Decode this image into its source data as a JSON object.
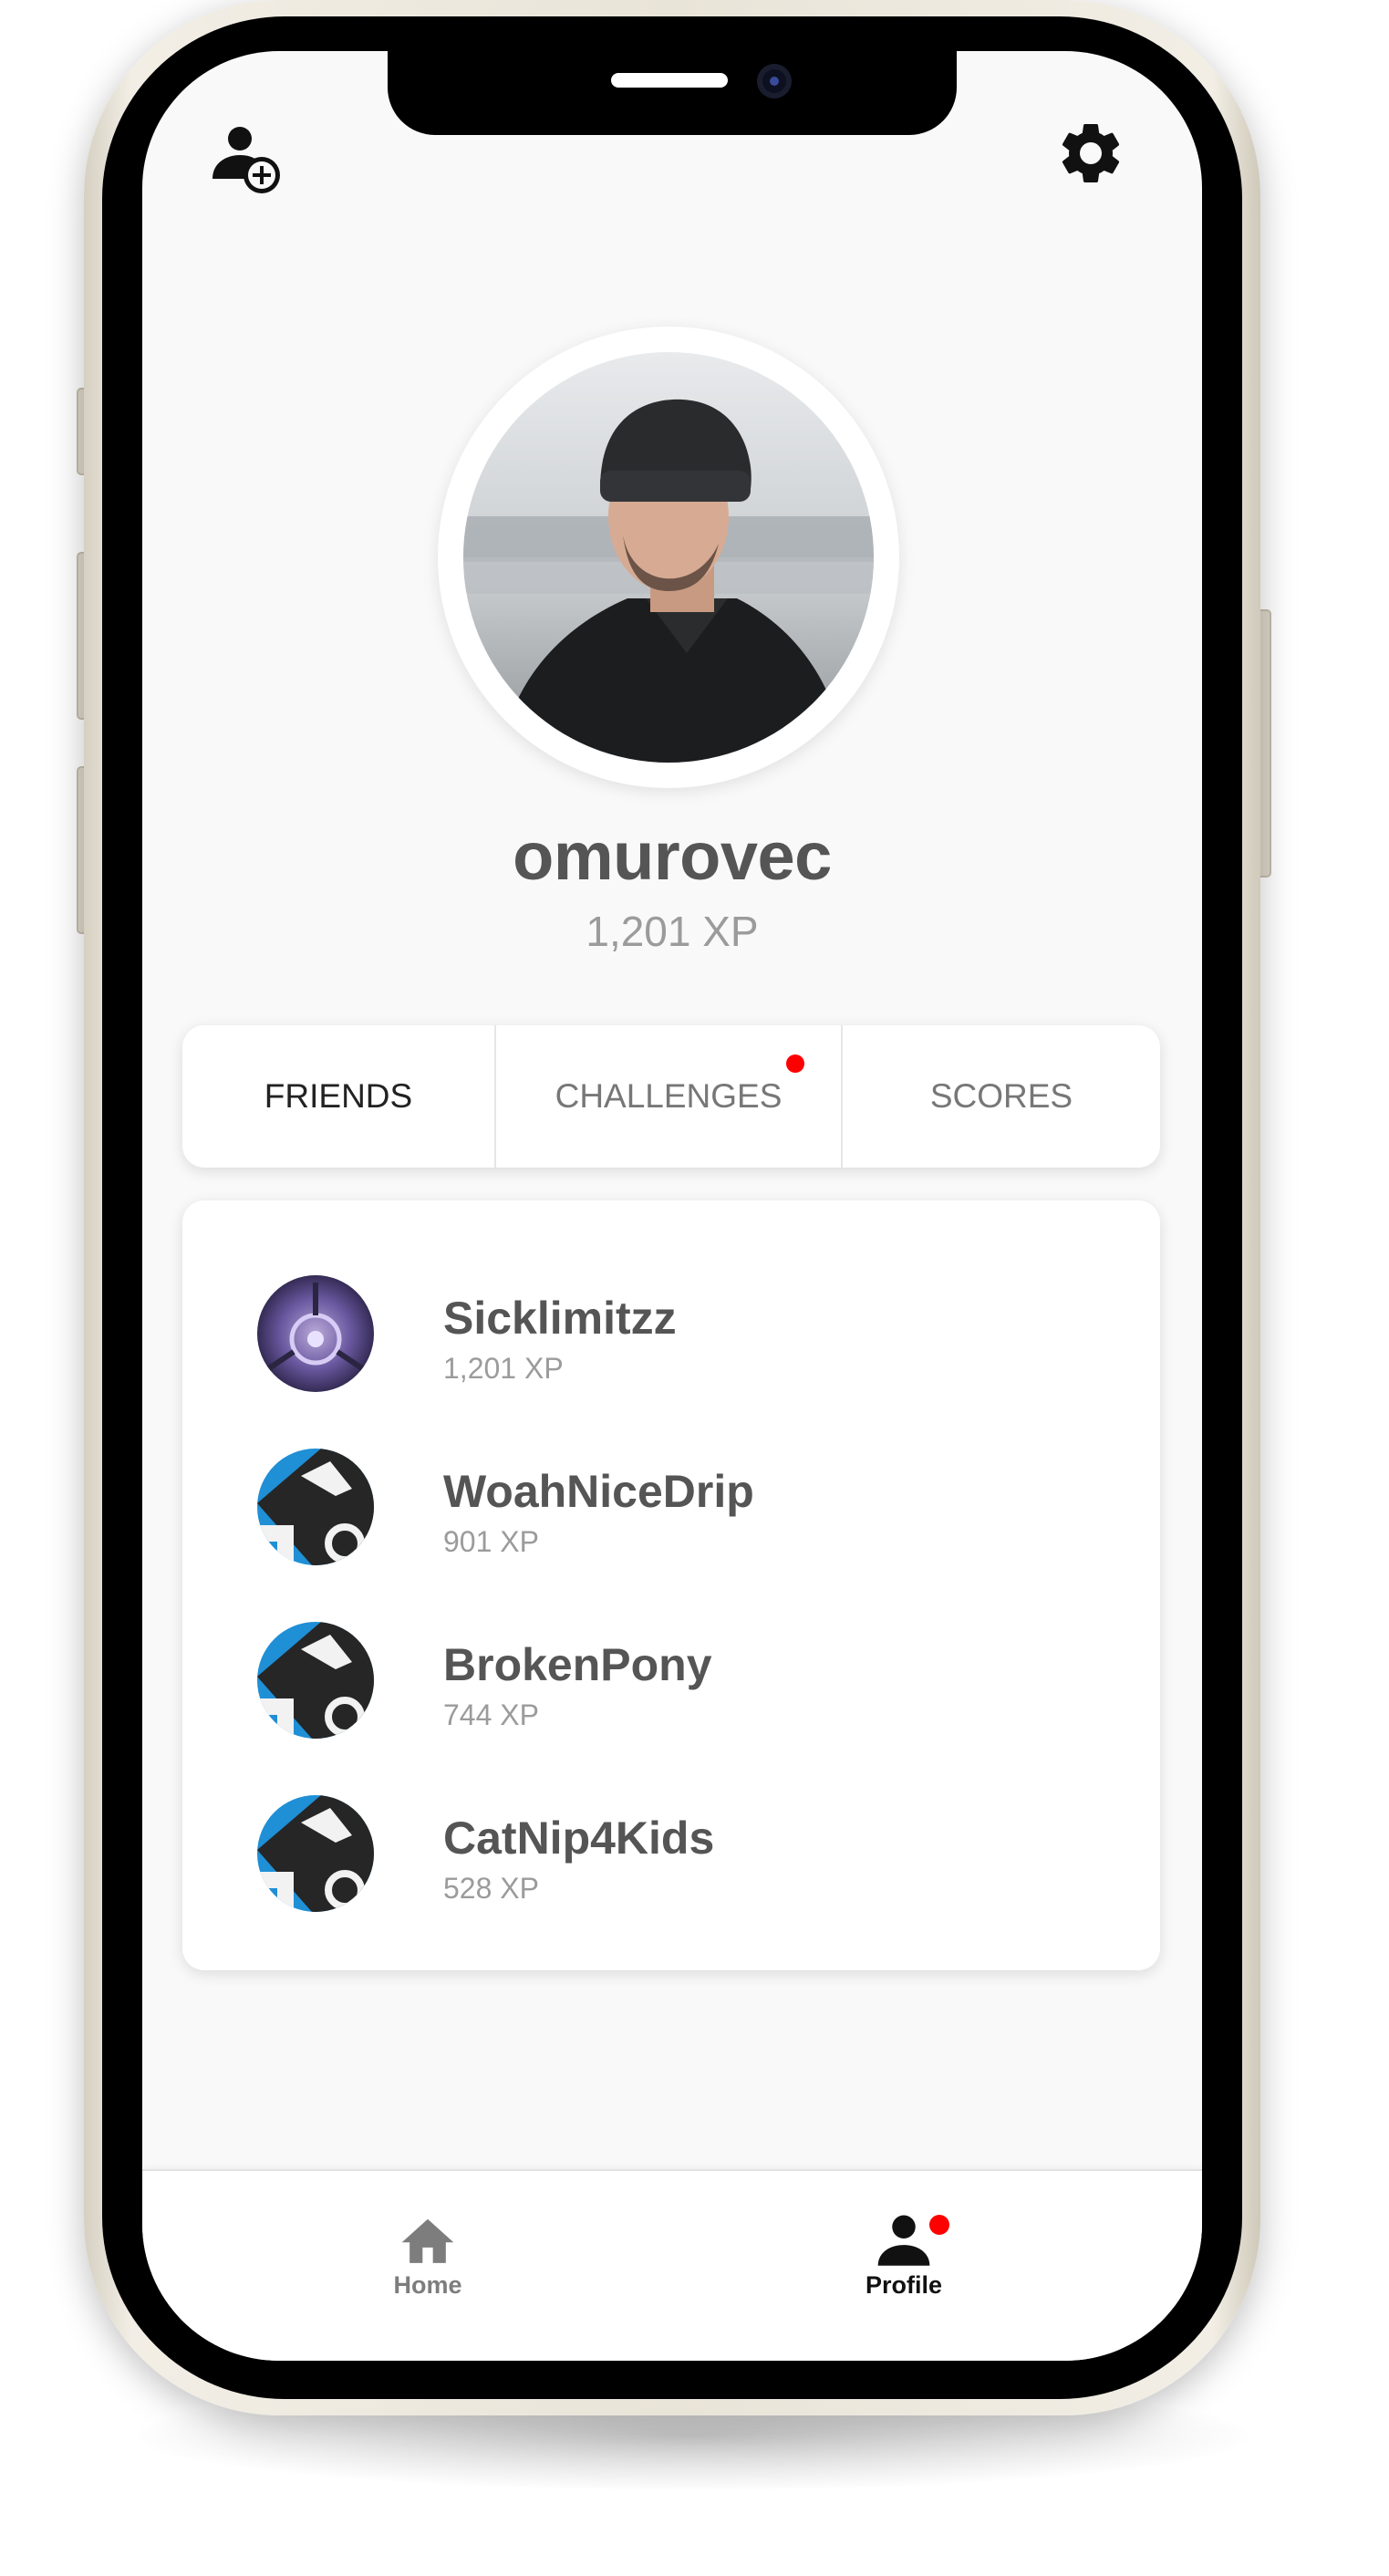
{
  "profile": {
    "username": "omurovec",
    "xp": "1,201 XP"
  },
  "tabs": [
    {
      "label": "FRIENDS",
      "active": true,
      "notification": false
    },
    {
      "label": "CHALLENGES",
      "active": false,
      "notification": true
    },
    {
      "label": "SCORES",
      "active": false,
      "notification": false
    }
  ],
  "friends": [
    {
      "name": "Sicklimitzz",
      "xp": "1,201 XP",
      "avatar": "purple-orb-avatar"
    },
    {
      "name": "WoahNiceDrip",
      "xp": "901 XP",
      "avatar": "blue-logo-avatar"
    },
    {
      "name": "BrokenPony",
      "xp": "744 XP",
      "avatar": "blue-logo-avatar"
    },
    {
      "name": "CatNip4Kids",
      "xp": "528 XP",
      "avatar": "blue-logo-avatar"
    }
  ],
  "nav": {
    "home_label": "Home",
    "profile_label": "Profile",
    "active": "profile"
  },
  "icons": {
    "top_left": "add-friend-icon",
    "top_right": "gear-icon"
  },
  "colors": {
    "notification": "#ff0000",
    "background": "#f9f9f9",
    "card": "#ffffff"
  }
}
